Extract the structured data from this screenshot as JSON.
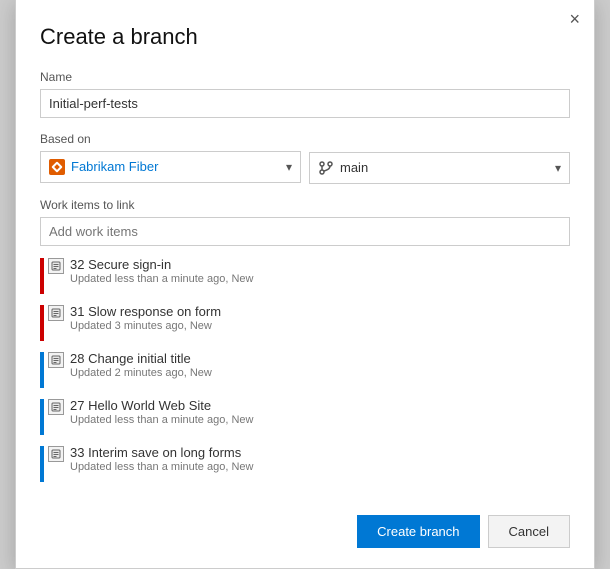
{
  "dialog": {
    "title": "Create a branch",
    "close_label": "×"
  },
  "name_field": {
    "label": "Name",
    "value": "Initial-perf-tests",
    "placeholder": ""
  },
  "based_on": {
    "label": "Based on",
    "repo": {
      "name": "Fabrikam Fiber"
    },
    "branch": {
      "name": "main"
    }
  },
  "work_items": {
    "label": "Work items to link",
    "placeholder": "Add work items",
    "items": [
      {
        "id": 32,
        "title": "Secure sign-in",
        "meta": "Updated less than a minute ago, New",
        "color": "red"
      },
      {
        "id": 31,
        "title": "Slow response on form",
        "meta": "Updated 3 minutes ago, New",
        "color": "red"
      },
      {
        "id": 28,
        "title": "Change initial title",
        "meta": "Updated 2 minutes ago, New",
        "color": "blue"
      },
      {
        "id": 27,
        "title": "Hello World Web Site",
        "meta": "Updated less than a minute ago, New",
        "color": "blue"
      },
      {
        "id": 33,
        "title": "Interim save on long forms",
        "meta": "Updated less than a minute ago, New",
        "color": "blue"
      }
    ]
  },
  "footer": {
    "create_label": "Create branch",
    "cancel_label": "Cancel"
  }
}
